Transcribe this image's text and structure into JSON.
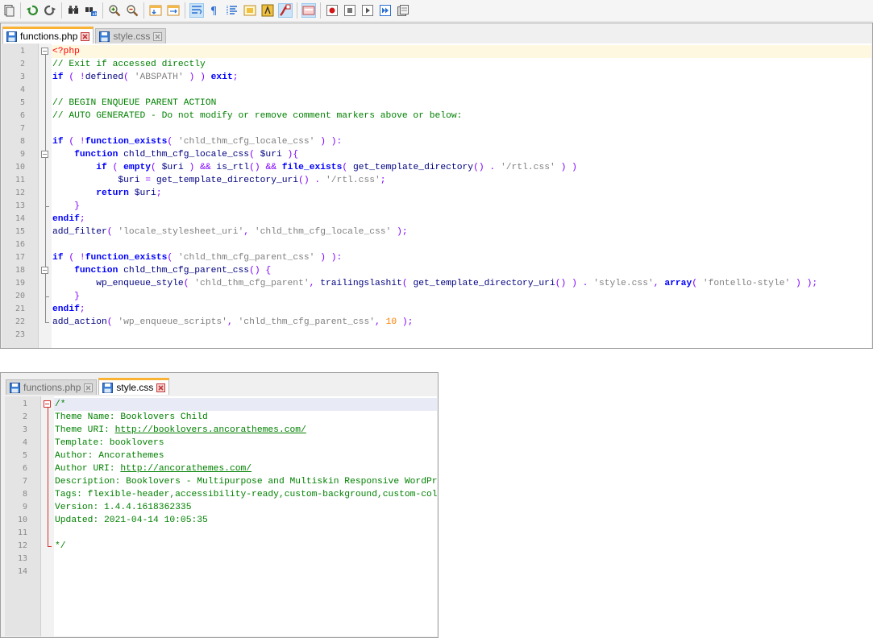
{
  "toolbar": {
    "icons": [
      "new-file-icon",
      "undo-icon",
      "redo-icon",
      "find-icon",
      "replace-icon",
      "zoom-in-icon",
      "zoom-out-icon",
      "sync-vertical-icon",
      "sync-horizontal-icon",
      "word-wrap-icon",
      "show-all-characters-icon",
      "indent-guide-icon",
      "document-map-icon",
      "function-list-icon",
      "folder-as-workspace-icon",
      "monitoring-icon",
      "start-recording-icon",
      "stop-recording-icon",
      "playback-icon",
      "run-macro-multiple-icon",
      "save-macro-icon"
    ]
  },
  "window1": {
    "tabs": [
      {
        "label": "functions.php",
        "active": true
      },
      {
        "label": "style.css",
        "active": false
      }
    ],
    "lines": [
      [
        [
          "ph",
          "<?php"
        ]
      ],
      [
        [
          "cm",
          "// Exit if accessed directly"
        ]
      ],
      [
        [
          "kw",
          "if"
        ],
        [
          "op",
          " ( !"
        ],
        [
          "fn",
          "defined"
        ],
        [
          "op",
          "( "
        ],
        [
          "str",
          "'ABSPATH'"
        ],
        [
          "op",
          " ) ) "
        ],
        [
          "kw",
          "exit"
        ],
        [
          "op",
          ";"
        ]
      ],
      [],
      [
        [
          "cm",
          "// BEGIN ENQUEUE PARENT ACTION"
        ]
      ],
      [
        [
          "cm",
          "// AUTO GENERATED - Do not modify or remove comment markers above or below:"
        ]
      ],
      [],
      [
        [
          "kw",
          "if"
        ],
        [
          "op",
          " ( !"
        ],
        [
          "kw",
          "function_exists"
        ],
        [
          "op",
          "( "
        ],
        [
          "str",
          "'chld_thm_cfg_locale_css'"
        ],
        [
          "op",
          " ) ):"
        ]
      ],
      [
        [
          "op",
          "    "
        ],
        [
          "kw",
          "function"
        ],
        [
          "op",
          " "
        ],
        [
          "fn",
          "chld_thm_cfg_locale_css"
        ],
        [
          "op",
          "( "
        ],
        [
          "vr",
          "$uri"
        ],
        [
          "op",
          " ){"
        ]
      ],
      [
        [
          "op",
          "        "
        ],
        [
          "kw",
          "if"
        ],
        [
          "op",
          " ( "
        ],
        [
          "kw",
          "empty"
        ],
        [
          "op",
          "( "
        ],
        [
          "vr",
          "$uri"
        ],
        [
          "op",
          " ) && "
        ],
        [
          "fn",
          "is_rtl"
        ],
        [
          "op",
          "() && "
        ],
        [
          "kw",
          "file_exists"
        ],
        [
          "op",
          "( "
        ],
        [
          "fn",
          "get_template_directory"
        ],
        [
          "op",
          "() . "
        ],
        [
          "str",
          "'/rtl.css'"
        ],
        [
          "op",
          " ) )"
        ]
      ],
      [
        [
          "op",
          "            "
        ],
        [
          "vr",
          "$uri"
        ],
        [
          "op",
          " = "
        ],
        [
          "fn",
          "get_template_directory_uri"
        ],
        [
          "op",
          "() . "
        ],
        [
          "str",
          "'/rtl.css'"
        ],
        [
          "op",
          ";"
        ]
      ],
      [
        [
          "op",
          "        "
        ],
        [
          "kw",
          "return"
        ],
        [
          "op",
          " "
        ],
        [
          "vr",
          "$uri"
        ],
        [
          "op",
          ";"
        ]
      ],
      [
        [
          "op",
          "    }"
        ]
      ],
      [
        [
          "kw",
          "endif"
        ],
        [
          "op",
          ";"
        ]
      ],
      [
        [
          "fn",
          "add_filter"
        ],
        [
          "op",
          "( "
        ],
        [
          "str",
          "'locale_stylesheet_uri'"
        ],
        [
          "op",
          ", "
        ],
        [
          "str",
          "'chld_thm_cfg_locale_css'"
        ],
        [
          "op",
          " );"
        ]
      ],
      [],
      [
        [
          "kw",
          "if"
        ],
        [
          "op",
          " ( !"
        ],
        [
          "kw",
          "function_exists"
        ],
        [
          "op",
          "( "
        ],
        [
          "str",
          "'chld_thm_cfg_parent_css'"
        ],
        [
          "op",
          " ) ):"
        ]
      ],
      [
        [
          "op",
          "    "
        ],
        [
          "kw",
          "function"
        ],
        [
          "op",
          " "
        ],
        [
          "fn",
          "chld_thm_cfg_parent_css"
        ],
        [
          "op",
          "() {"
        ]
      ],
      [
        [
          "op",
          "        "
        ],
        [
          "fn",
          "wp_enqueue_style"
        ],
        [
          "op",
          "( "
        ],
        [
          "str",
          "'chld_thm_cfg_parent'"
        ],
        [
          "op",
          ", "
        ],
        [
          "fn",
          "trailingslashit"
        ],
        [
          "op",
          "( "
        ],
        [
          "fn",
          "get_template_directory_uri"
        ],
        [
          "op",
          "() ) . "
        ],
        [
          "str",
          "'style.css'"
        ],
        [
          "op",
          ", "
        ],
        [
          "kw",
          "array"
        ],
        [
          "op",
          "( "
        ],
        [
          "str",
          "'fontello-style'"
        ],
        [
          "op",
          " ) );"
        ]
      ],
      [
        [
          "op",
          "    }"
        ]
      ],
      [
        [
          "kw",
          "endif"
        ],
        [
          "op",
          ";"
        ]
      ],
      [
        [
          "fn",
          "add_action"
        ],
        [
          "op",
          "( "
        ],
        [
          "str",
          "'wp_enqueue_scripts'"
        ],
        [
          "op",
          ", "
        ],
        [
          "str",
          "'chld_thm_cfg_parent_css'"
        ],
        [
          "op",
          ", "
        ],
        [
          "num",
          "10"
        ],
        [
          "op",
          " );"
        ]
      ],
      []
    ]
  },
  "window2": {
    "tabs": [
      {
        "label": "functions.php",
        "active": false
      },
      {
        "label": "style.css",
        "active": true
      }
    ],
    "lines": [
      [
        [
          "cm",
          "/*"
        ]
      ],
      [
        [
          "cm",
          "Theme Name: Booklovers Child"
        ]
      ],
      [
        [
          "cm",
          "Theme URI: "
        ],
        [
          "url",
          "http://booklovers.ancorathemes.com/"
        ]
      ],
      [
        [
          "cm",
          "Template: booklovers"
        ]
      ],
      [
        [
          "cm",
          "Author: Ancorathemes"
        ]
      ],
      [
        [
          "cm",
          "Author URI: "
        ],
        [
          "url",
          "http://ancorathemes.com/"
        ]
      ],
      [
        [
          "cm",
          "Description: Booklovers - Multipurpose and Multiskin Responsive WordPress Theme"
        ]
      ],
      [
        [
          "cm",
          "Tags: flexible-header,accessibility-ready,custom-background,custom-colors"
        ]
      ],
      [
        [
          "cm",
          "Version: 1.4.4.1618362335"
        ]
      ],
      [
        [
          "cm",
          "Updated: 2021-04-14 10:05:35"
        ]
      ],
      [],
      [
        [
          "cm",
          "*/"
        ]
      ],
      [],
      []
    ]
  }
}
